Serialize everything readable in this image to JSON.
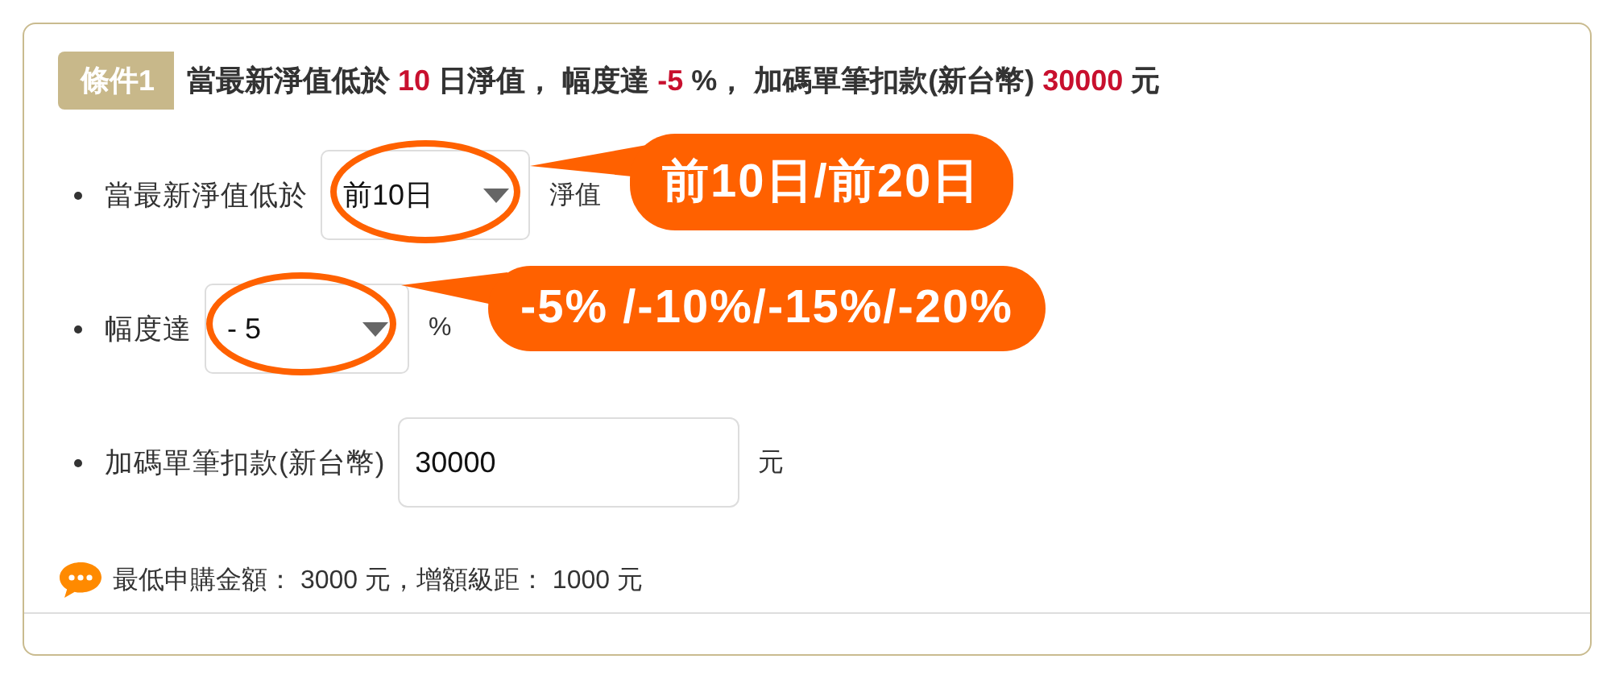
{
  "condition": {
    "badge": "條件1",
    "heading": [
      {
        "text": "當最新淨值低於 ",
        "highlight": false
      },
      {
        "text": "10",
        "highlight": true
      },
      {
        "text": " 日淨值， 幅度達 ",
        "highlight": false
      },
      {
        "text": "-5",
        "highlight": true
      },
      {
        "text": " %， 加碼單筆扣款(新台幣) ",
        "highlight": false
      },
      {
        "text": "30000",
        "highlight": true
      },
      {
        "text": " 元",
        "highlight": false
      }
    ],
    "rows": [
      {
        "kind": "select",
        "label": "當最新淨值低於",
        "value": "前10日",
        "unit": "淨值"
      },
      {
        "kind": "select",
        "label": "幅度達",
        "value": "- 5",
        "unit": "%"
      },
      {
        "kind": "input",
        "label": "加碼單筆扣款(新台幣)",
        "value": "30000",
        "unit": "元"
      }
    ],
    "note": "最低申購金額： 3000 元，增額級距： 1000 元"
  },
  "callouts": [
    {
      "text": "前10日/前20日"
    },
    {
      "text": "-5% /-10%/-15%/-20%"
    }
  ]
}
